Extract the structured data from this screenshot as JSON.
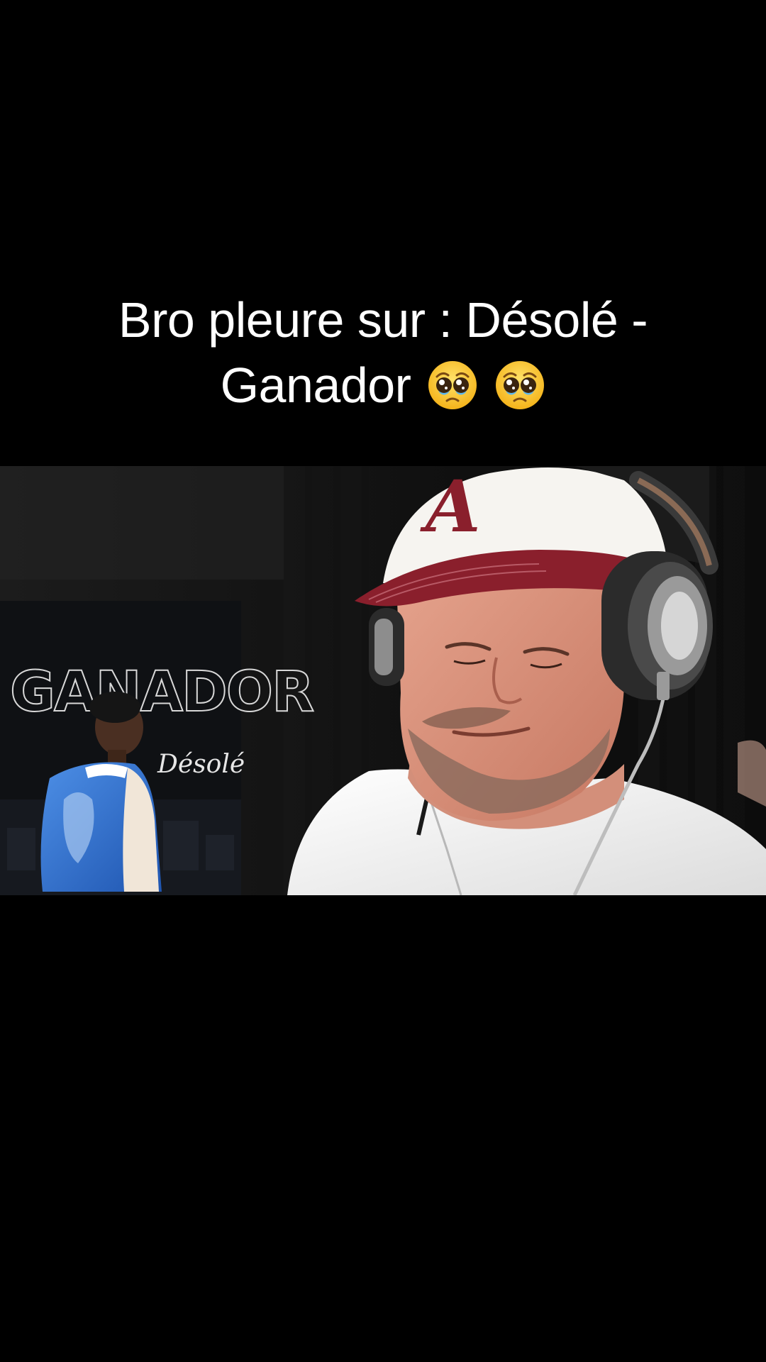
{
  "caption": {
    "line1": "Bro pleure sur : Désolé -",
    "line2_text": "Ganador",
    "emojis": [
      "pleading-face-emoji",
      "pleading-face-emoji"
    ]
  },
  "video": {
    "cover_art_title": "GANADOR",
    "cover_art_script": "Désolé",
    "cap_logo": "A",
    "colors": {
      "background": "#000000",
      "cap_maroon": "#8a1f2c",
      "jacket_blue": "#2f6fd0"
    }
  }
}
